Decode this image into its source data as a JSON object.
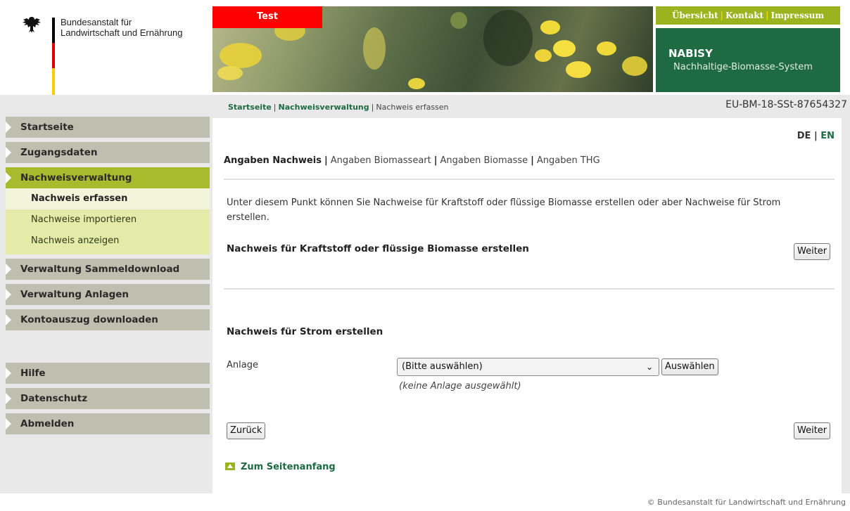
{
  "header": {
    "org_name_line1": "Bundesanstalt für",
    "org_name_line2": "Landwirtschaft und Ernährung",
    "test_badge": "Test",
    "toplinks": [
      "Übersicht",
      "Kontakt",
      "Impressum"
    ],
    "system_name": "NABISY",
    "system_subtitle": "Nachhaltige-Biomasse-System"
  },
  "breadcrumb": {
    "items": [
      "Startseite",
      "Nachweisverwaltung",
      "Nachweis erfassen"
    ],
    "account_id": "EU-BM-18-SSt-87654327"
  },
  "sidebar": {
    "items": [
      "Startseite",
      "Zugangsdaten",
      "Nachweisverwaltung",
      "Verwaltung Sammeldownload",
      "Verwaltung Anlagen",
      "Kontoauszug downloaden",
      "Hilfe",
      "Datenschutz",
      "Abmelden"
    ],
    "subitems": [
      "Nachweis erfassen",
      "Nachweise importieren",
      "Nachweis anzeigen"
    ]
  },
  "main": {
    "lang": {
      "de": "DE",
      "sep": "|",
      "en": "EN"
    },
    "tabs": [
      "Angaben Nachweis",
      "Angaben Biomasseart",
      "Angaben Biomasse",
      "Angaben THG"
    ],
    "intro": "Unter diesem Punkt können Sie Nachweise für Kraftstoff oder flüssige Biomasse erstellen oder aber Nachweise für Strom erstellen.",
    "section1_title": "Nachweis für Kraftstoff oder flüssige Biomasse erstellen",
    "weiter_label": "Weiter",
    "section2_title": "Nachweis für Strom erstellen",
    "anlage_label": "Anlage",
    "anlage_selected": "(Bitte auswählen)",
    "auswaehlen_label": "Auswählen",
    "anlage_hint": "(keine Anlage ausgewählt)",
    "zurueck_label": "Zurück",
    "weiter2_label": "Weiter",
    "back_to_top": "Zum Seitenanfang"
  },
  "footer": {
    "copyright": "© Bundesanstalt für Landwirtschaft und Ernährung"
  },
  "colors": {
    "brand_green": "#1e6a42",
    "accent_lime": "#9ab31e",
    "test_red": "#ff0000"
  }
}
